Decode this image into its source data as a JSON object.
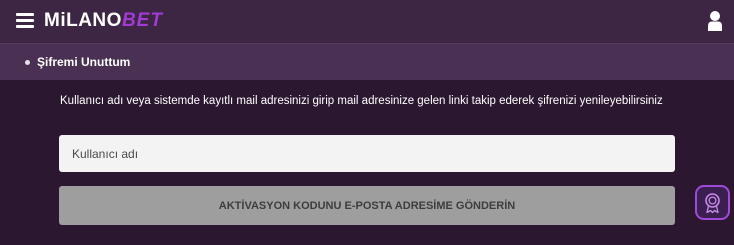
{
  "header": {
    "logo_part1": "MiLANO",
    "logo_part2": "BET",
    "icons": {
      "menu": "hamburger-menu-icon",
      "user": "user-icon"
    }
  },
  "breadcrumb": {
    "label": "Şifremi Unuttum"
  },
  "form": {
    "instructions": "Kullanıcı adı veya sistemde kayıtlı mail adresinizi girip mail adresinize gelen linki takip ederek şifrenizi yenileyebilirsiniz",
    "username_placeholder": "Kullanıcı adı",
    "username_value": "",
    "submit_label": "AKTİVASYON KODUNU E-POSTA ADRESİME GÖNDERİN"
  },
  "floating": {
    "icon": "award-badge-icon"
  },
  "colors": {
    "header_bg": "#3d2644",
    "breadcrumb_bg": "#4a3052",
    "content_bg": "#2b1730",
    "brand_accent": "#a23bd3",
    "button_bg": "#9e9e9e"
  }
}
